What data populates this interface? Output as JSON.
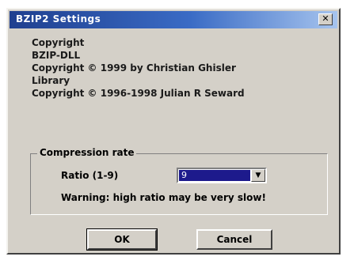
{
  "window": {
    "title": "BZIP2 Settings",
    "close_glyph": "✕"
  },
  "copyright": {
    "lines": [
      "Copyright",
      "BZIP-DLL",
      "Copyright © 1999 by Christian Ghisler",
      "Library",
      "Copyright © 1996-1998 Julian R Seward"
    ]
  },
  "compression": {
    "group_label": "Compression rate",
    "ratio_label": "Ratio (1-9)",
    "ratio_value": "9",
    "warning": "Warning: high ratio may be very slow!"
  },
  "buttons": {
    "ok_label": "OK",
    "cancel_label": "Cancel"
  },
  "colors": {
    "face": "#d4d0c8",
    "title_start": "#1f3f8f",
    "title_end": "#a6c4ee",
    "selection": "#1d1a8c"
  }
}
